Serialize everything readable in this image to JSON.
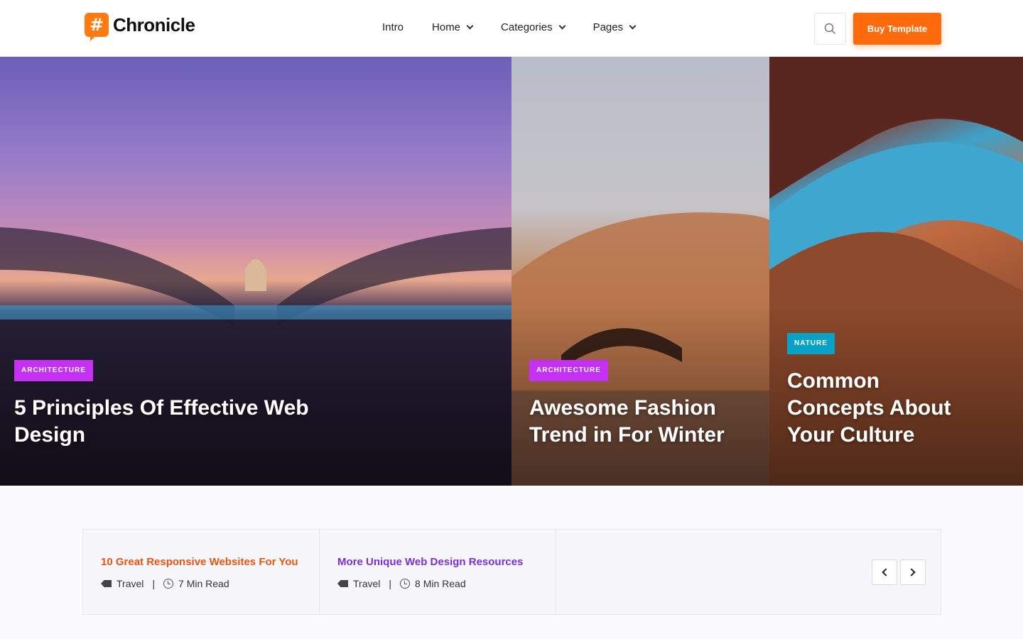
{
  "header": {
    "logo_glyph": "#",
    "logo_text": "Chronicle",
    "nav": [
      {
        "label": "Intro",
        "dropdown": false
      },
      {
        "label": "Home",
        "dropdown": true
      },
      {
        "label": "Categories",
        "dropdown": true
      },
      {
        "label": "Pages",
        "dropdown": true
      }
    ],
    "search_icon": "search-icon",
    "buy_label": "Buy Template",
    "accent": "#ff6a0d"
  },
  "hero": [
    {
      "badge": "ARCHITECTURE",
      "badge_color": "#c531f2",
      "title_lines": [
        "5 Principles Of Effective Web",
        "Design"
      ]
    },
    {
      "badge": "ARCHITECTURE",
      "badge_color": "#c531f2",
      "title_lines": [
        "Awesome Fashion",
        "Trend in For Winter"
      ]
    },
    {
      "badge": "NATURE",
      "badge_color": "#0aa2c4",
      "title_lines": [
        "Common",
        "Concepts About",
        "Your Culture"
      ]
    }
  ],
  "strip": {
    "posts": [
      {
        "title": "10 Great Responsive Websites For You",
        "title_color": "#e8550f",
        "category": "Travel",
        "read_time": "7 Min Read"
      },
      {
        "title": "More Unique Web Design Resources",
        "title_color": "#7a2fd6",
        "category": "Travel",
        "read_time": "8 Min Read"
      }
    ],
    "separator": "|",
    "prev_icon": "chevron-left-icon",
    "next_icon": "chevron-right-icon"
  }
}
